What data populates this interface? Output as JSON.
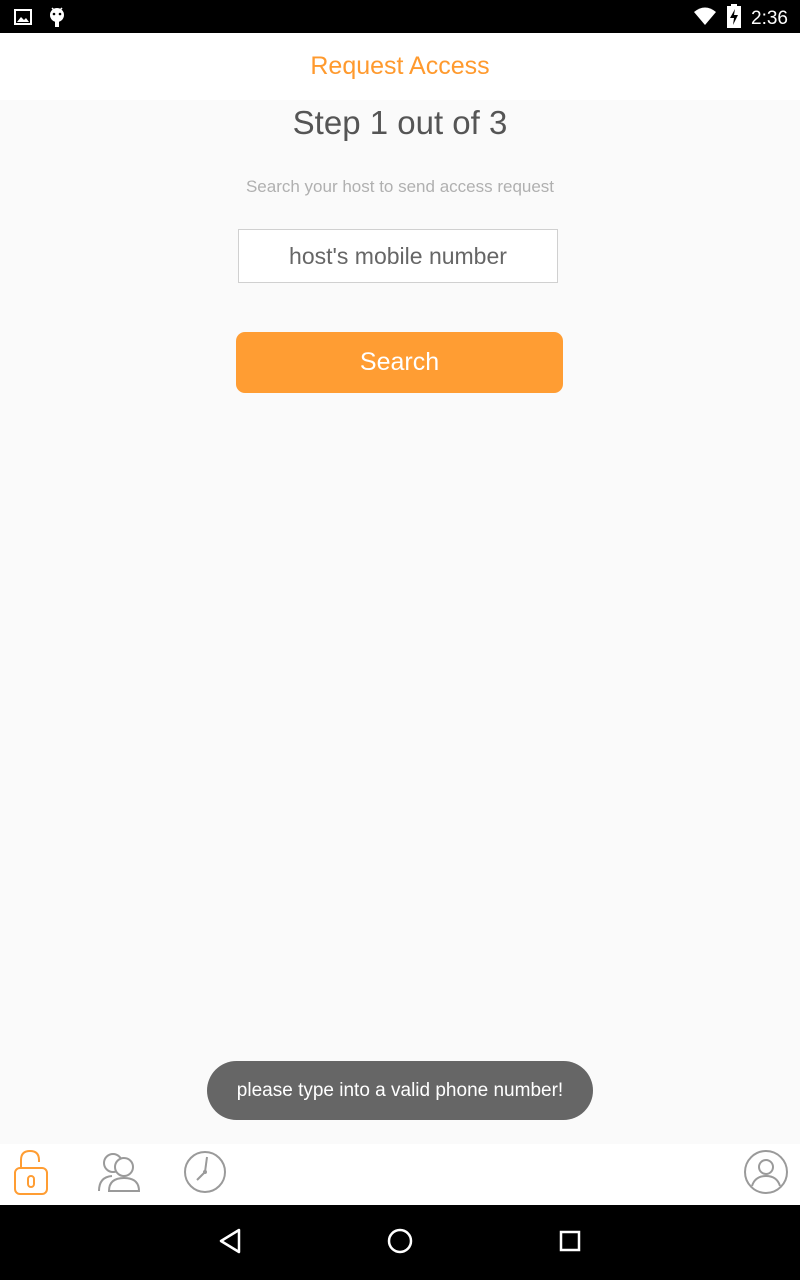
{
  "status_bar": {
    "time": "2:36",
    "left_icons": [
      "image-icon",
      "android-debug-icon"
    ],
    "right_icons": [
      "wifi-icon",
      "battery-charging-icon"
    ]
  },
  "app_bar": {
    "title": "Request Access"
  },
  "content": {
    "step_title": "Step 1 out of 3",
    "instruction": "Search your host to send access request",
    "phone_input": {
      "placeholder": "host's mobile number",
      "value": ""
    },
    "search_button_label": "Search"
  },
  "toast": {
    "message": "please type into a valid phone number!"
  },
  "tab_bar": {
    "tabs": [
      {
        "icon": "unlock-icon",
        "active": true
      },
      {
        "icon": "people-icon",
        "active": false
      },
      {
        "icon": "clock-icon",
        "active": false
      },
      {
        "icon": "profile-icon",
        "active": false
      }
    ]
  },
  "nav_bar": {
    "buttons": [
      "back-icon",
      "home-icon",
      "recents-icon"
    ]
  },
  "colors": {
    "accent": "#ff9d33",
    "title": "#ff9a2e",
    "toast_bg": "#666666",
    "icon_inactive": "#9a9a9a"
  }
}
